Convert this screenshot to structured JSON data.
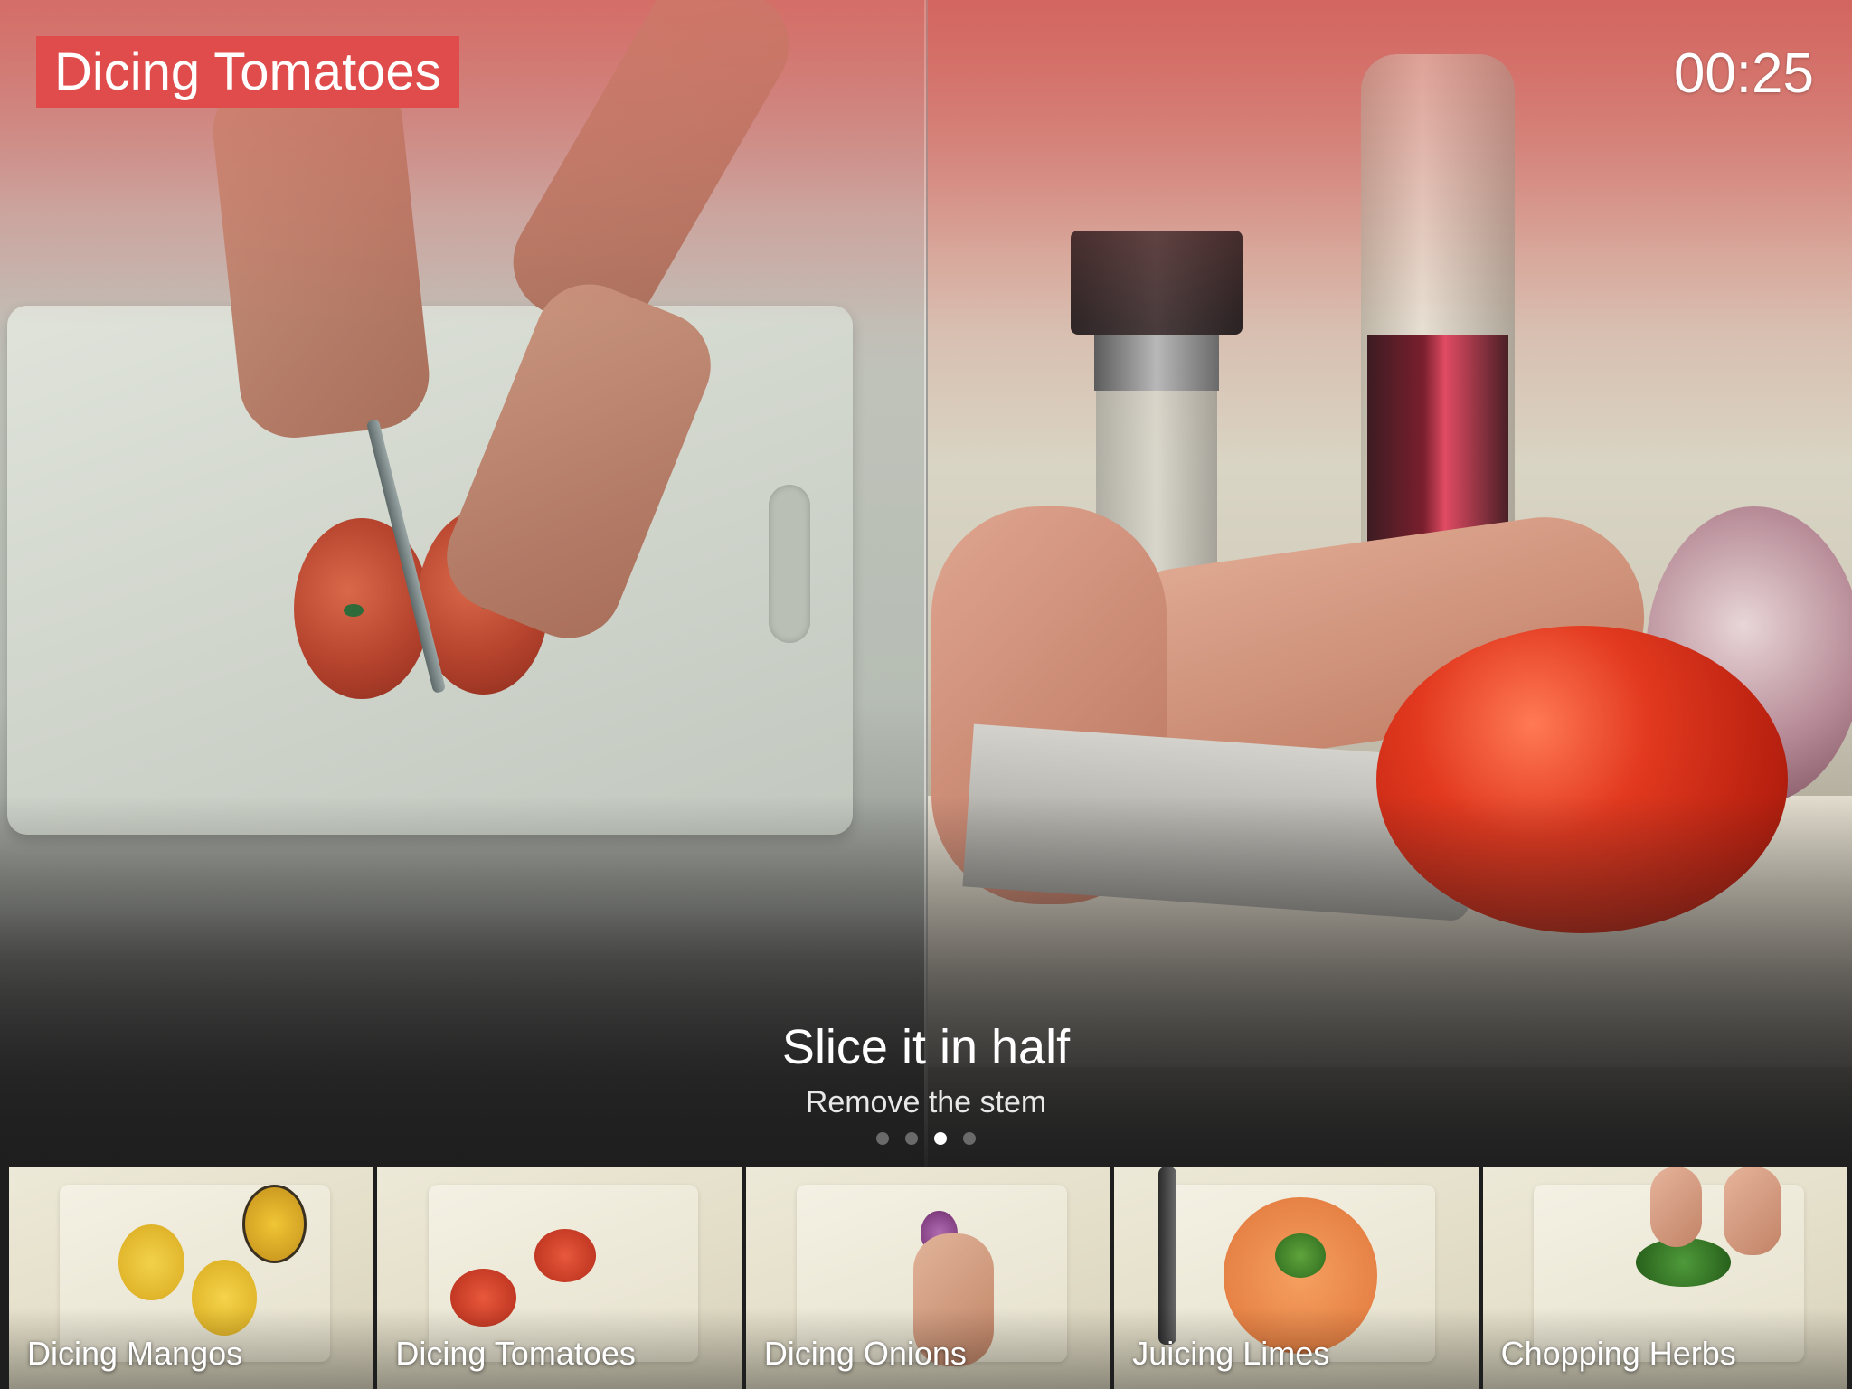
{
  "video": {
    "title": "Dicing Tomatoes",
    "timer": "00:25"
  },
  "step": {
    "title": "Slice it in half",
    "subtitle": "Remove the stem"
  },
  "pager": {
    "count": 4,
    "active_index": 2
  },
  "thumbnails": [
    {
      "label": "Dicing Mangos"
    },
    {
      "label": "Dicing Tomatoes"
    },
    {
      "label": "Dicing Onions"
    },
    {
      "label": "Juicing Limes"
    },
    {
      "label": "Chopping Herbs"
    }
  ],
  "colors": {
    "accent": "#e04b4b",
    "background": "#1e1e1e",
    "dot_active": "#ffffff",
    "dot_inactive": "#6a6a6a"
  }
}
